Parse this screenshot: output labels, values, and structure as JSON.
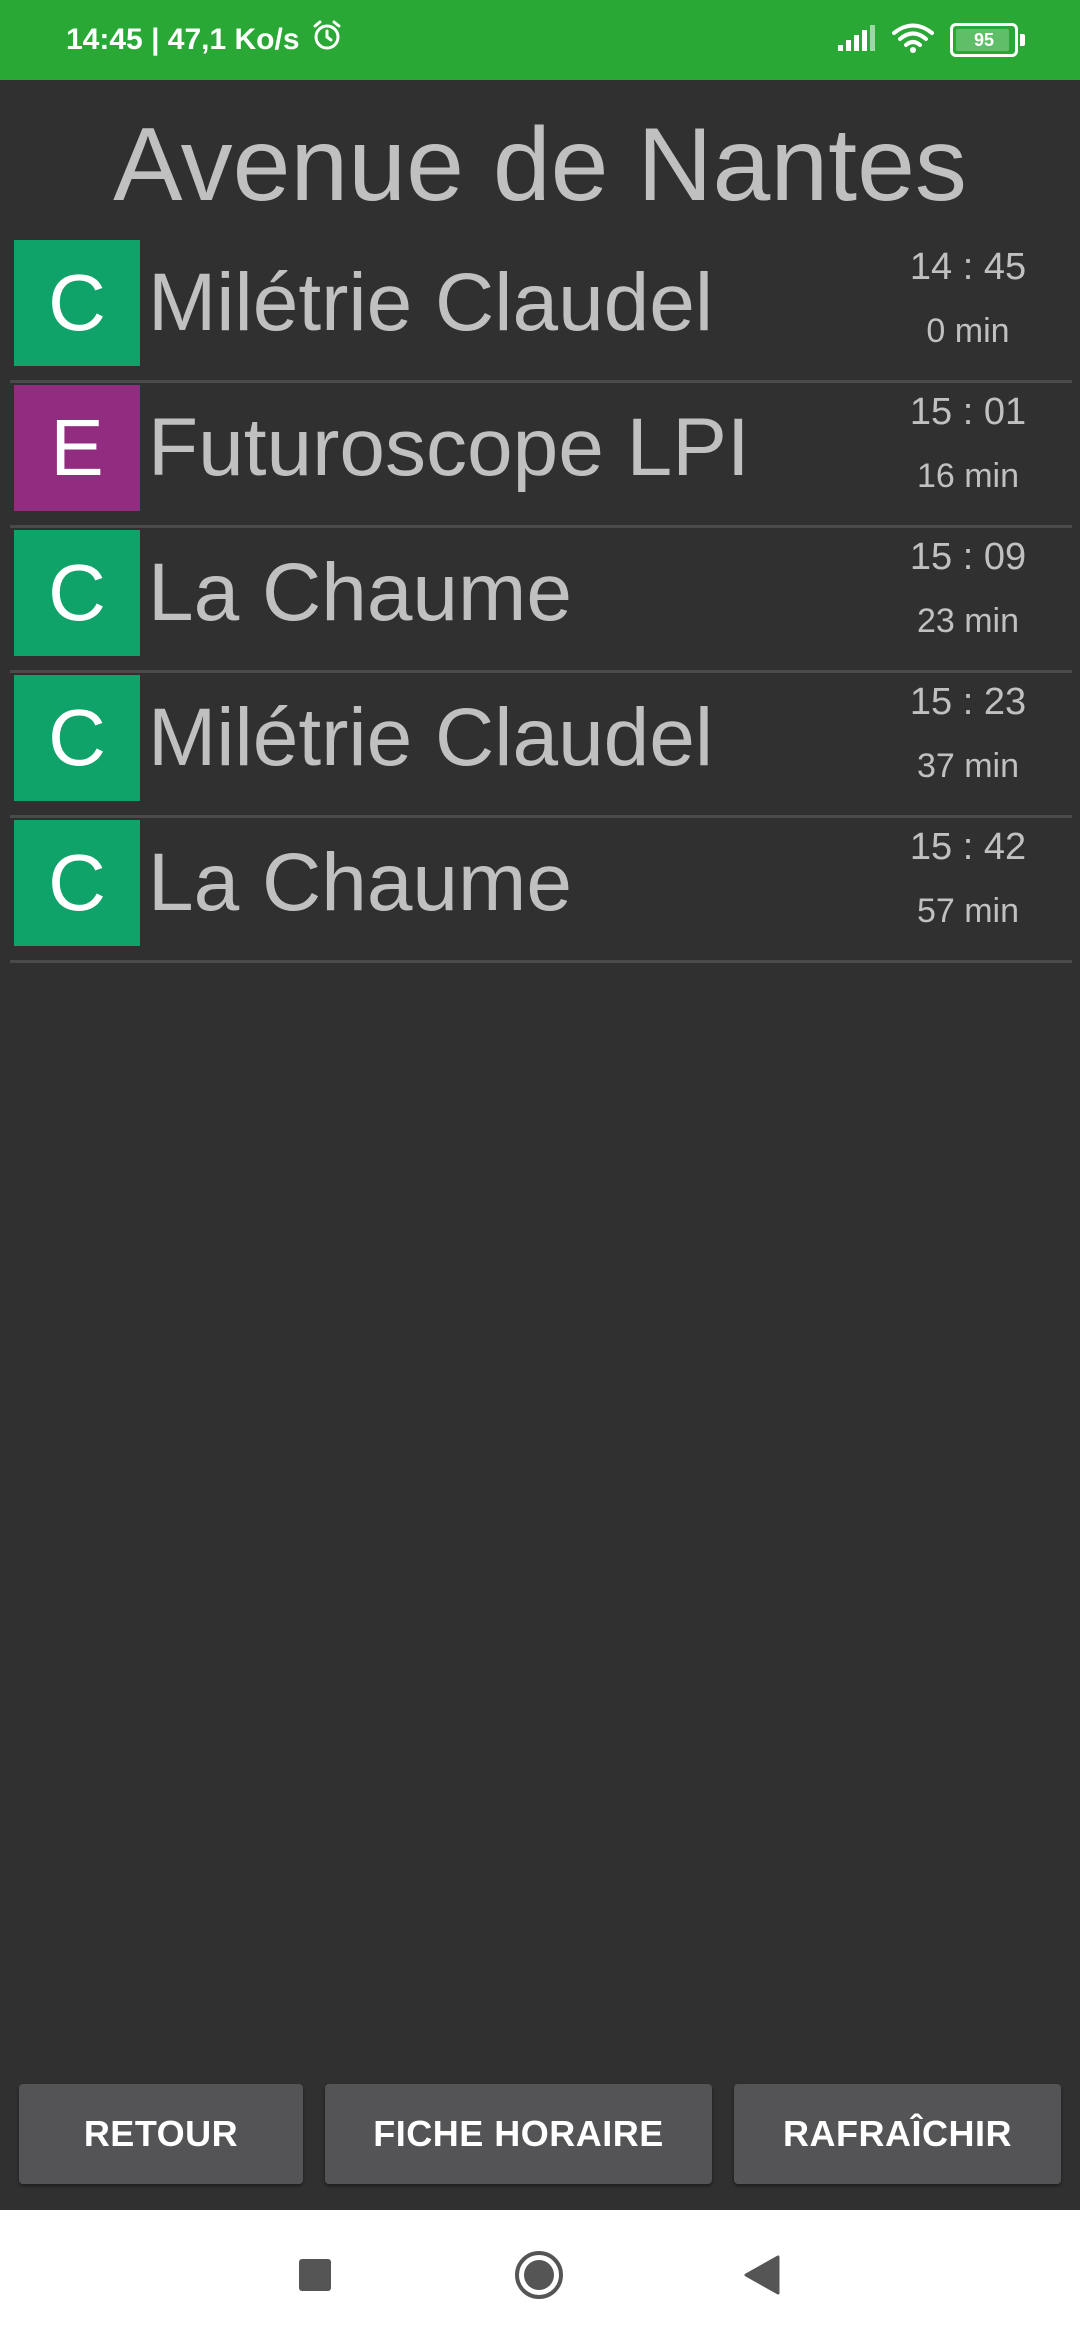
{
  "status_bar": {
    "time_speed": "14:45 | 47,1 Ko/s",
    "battery": "95"
  },
  "stop_name": "Avenue de Nantes",
  "departures": [
    {
      "line": "C",
      "color": "#0fa36a",
      "destination": "Milétrie Claudel",
      "time": "14 : 45",
      "wait": "0 min"
    },
    {
      "line": "E",
      "color": "#922c80",
      "destination": "Futuroscope LPI",
      "time": "15 : 01",
      "wait": "16 min"
    },
    {
      "line": "C",
      "color": "#0fa36a",
      "destination": "La Chaume",
      "time": "15 : 09",
      "wait": "23 min"
    },
    {
      "line": "C",
      "color": "#0fa36a",
      "destination": "Milétrie Claudel",
      "time": "15 : 23",
      "wait": "37 min"
    },
    {
      "line": "C",
      "color": "#0fa36a",
      "destination": "La Chaume",
      "time": "15 : 42",
      "wait": "57 min"
    }
  ],
  "buttons": {
    "back": "RETOUR",
    "schedule": "FICHE HORAIRE",
    "refresh": "RAFRAÎCHIR"
  },
  "icons": {
    "alarm": "alarm-icon",
    "signal": "signal-icon",
    "wifi": "wifi-icon",
    "battery": "battery-icon",
    "nav_recents": "square-icon",
    "nav_home": "circle-icon",
    "nav_back": "triangle-back-icon"
  }
}
